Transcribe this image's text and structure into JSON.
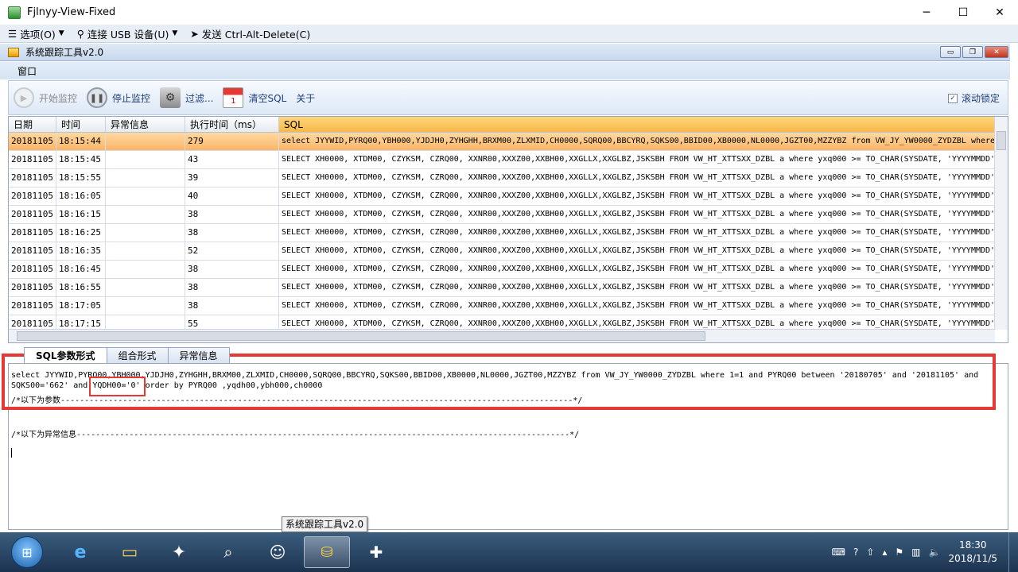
{
  "window": {
    "title": "Fjlnyy-View-Fixed",
    "minimize": "─",
    "maximize": "☐",
    "close": "✕"
  },
  "outer_menu": {
    "options": "选项(O)",
    "usb": "连接 USB 设备(U)",
    "send": "发送 Ctrl-Alt-Delete(C)"
  },
  "inner_window": {
    "title": "系统跟踪工具v2.0",
    "min": "▭",
    "restore": "❐",
    "close": "✕"
  },
  "menu": {
    "window": "窗口"
  },
  "toolbar": {
    "start": "开始监控",
    "stop": "停止监控",
    "filter": "过滤...",
    "clear": "清空SQL",
    "about": "关于",
    "scroll_lock": "滚动锁定"
  },
  "grid": {
    "headers": [
      "日期",
      "时间",
      "异常信息",
      "执行时间（ms）",
      "SQL"
    ],
    "rows": [
      [
        "20181105",
        "18:15:44",
        "",
        "279",
        "select JYYWID,PYRQ00,YBH000,YJDJH0,ZYHGHH,BRXM00,ZLXMID,CH0000,SQRQ00,BBCYRQ,SQKS00,BBID00,XB0000,NL0000,JGZT00,MZZYBZ from VW_JY_YW0000_ZYDZBL where"
      ],
      [
        "20181105",
        "18:15:45",
        "",
        "43",
        "SELECT XH0000, XTDM00, CZYKSM, CZRQ00, XXNR00,XXXZ00,XXBH00,XXGLLX,XXGLBZ,JSKSBH  FROM VW_HT_XTTSXX_DZBL a where yxq000 >= TO_CHAR(SYSDATE, 'YYYYMMDD'"
      ],
      [
        "20181105",
        "18:15:55",
        "",
        "39",
        "SELECT XH0000, XTDM00, CZYKSM, CZRQ00, XXNR00,XXXZ00,XXBH00,XXGLLX,XXGLBZ,JSKSBH  FROM VW_HT_XTTSXX_DZBL a where yxq000 >= TO_CHAR(SYSDATE, 'YYYYMMDD'"
      ],
      [
        "20181105",
        "18:16:05",
        "",
        "40",
        "SELECT XH0000, XTDM00, CZYKSM, CZRQ00, XXNR00,XXXZ00,XXBH00,XXGLLX,XXGLBZ,JSKSBH  FROM VW_HT_XTTSXX_DZBL a where yxq000 >= TO_CHAR(SYSDATE, 'YYYYMMDD'"
      ],
      [
        "20181105",
        "18:16:15",
        "",
        "38",
        "SELECT XH0000, XTDM00, CZYKSM, CZRQ00, XXNR00,XXXZ00,XXBH00,XXGLLX,XXGLBZ,JSKSBH  FROM VW_HT_XTTSXX_DZBL a where yxq000 >= TO_CHAR(SYSDATE, 'YYYYMMDD'"
      ],
      [
        "20181105",
        "18:16:25",
        "",
        "38",
        "SELECT XH0000, XTDM00, CZYKSM, CZRQ00, XXNR00,XXXZ00,XXBH00,XXGLLX,XXGLBZ,JSKSBH  FROM VW_HT_XTTSXX_DZBL a where yxq000 >= TO_CHAR(SYSDATE, 'YYYYMMDD'"
      ],
      [
        "20181105",
        "18:16:35",
        "",
        "52",
        "SELECT XH0000, XTDM00, CZYKSM, CZRQ00, XXNR00,XXXZ00,XXBH00,XXGLLX,XXGLBZ,JSKSBH  FROM VW_HT_XTTSXX_DZBL a where yxq000 >= TO_CHAR(SYSDATE, 'YYYYMMDD'"
      ],
      [
        "20181105",
        "18:16:45",
        "",
        "38",
        "SELECT XH0000, XTDM00, CZYKSM, CZRQ00, XXNR00,XXXZ00,XXBH00,XXGLLX,XXGLBZ,JSKSBH  FROM VW_HT_XTTSXX_DZBL a where yxq000 >= TO_CHAR(SYSDATE, 'YYYYMMDD'"
      ],
      [
        "20181105",
        "18:16:55",
        "",
        "38",
        "SELECT XH0000, XTDM00, CZYKSM, CZRQ00, XXNR00,XXXZ00,XXBH00,XXGLLX,XXGLBZ,JSKSBH  FROM VW_HT_XTTSXX_DZBL a where yxq000 >= TO_CHAR(SYSDATE, 'YYYYMMDD'"
      ],
      [
        "20181105",
        "18:17:05",
        "",
        "38",
        "SELECT XH0000, XTDM00, CZYKSM, CZRQ00, XXNR00,XXXZ00,XXBH00,XXGLLX,XXGLBZ,JSKSBH  FROM VW_HT_XTTSXX_DZBL a where yxq000 >= TO_CHAR(SYSDATE, 'YYYYMMDD'"
      ],
      [
        "20181105",
        "18:17:15",
        "",
        "55",
        "SELECT XH0000, XTDM00, CZYKSM, CZRQ00, XXNR00,XXXZ00,XXBH00,XXGLLX,XXGLBZ,JSKSBH  FROM VW_HT_XTTSXX_DZBL a where yxq000 >= TO_CHAR(SYSDATE, 'YYYYMMDD'"
      ]
    ]
  },
  "tabs": [
    "SQL参数形式",
    "组合形式",
    "异常信息"
  ],
  "detail": {
    "sql": "select JYYWID,PYRQ00,YBH000,YJDJH0,ZYHGHH,BRXM00,ZLXMID,CH0000,SQRQ00,BBCYRQ,SQKS00,BBID00,XB0000,NL0000,JGZT00,MZZYBZ from VW_JY_YW0000_ZYDZBL where 1=1  and PYRQ00 between '20180705' and '20181105'  and SQKS00='662'  and YQDH00='0'  order by PYRQ00 ,yqdh00,ybh000,ch0000",
    "params_line": "/*以下为参数-----------------------------------------------------------------------------------------------------------*/",
    "errors_line": "/*以下为异常信息-------------------------------------------------------------------------------------------------------*/"
  },
  "tooltip": "系统跟踪工具v2.0",
  "clock": {
    "time": "18:30",
    "date": "2018/11/5"
  }
}
